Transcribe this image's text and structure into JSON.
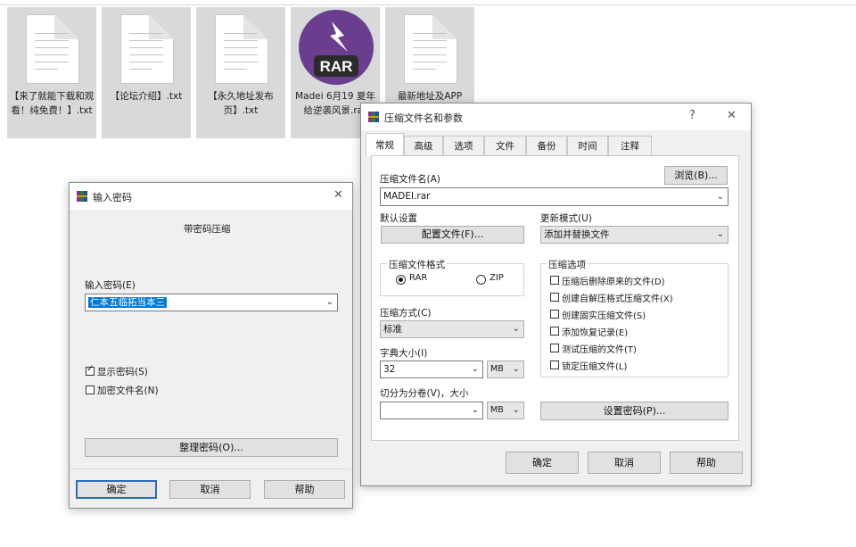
{
  "desktop": {
    "files": [
      {
        "label": "【来了就能下载和观看！纯免费！】.txt"
      },
      {
        "label": "【论坛介绍】.txt"
      },
      {
        "label": "【永久地址发布页】.txt"
      },
      {
        "label": "Madei 6月19 夏年给逆袭风景.rar",
        "badge": "RAR"
      },
      {
        "label": "最新地址及APP"
      }
    ]
  },
  "password_dialog": {
    "title": "输入密码",
    "heading": "带密码压缩",
    "password_label": "输入密码(E)",
    "password_value": "仁本五临拓当本三",
    "show_password_label": "显示密码(S)",
    "show_password_checked": true,
    "encrypt_names_label": "加密文件名(N)",
    "encrypt_names_checked": false,
    "manage_button": "整理密码(O)...",
    "ok_button": "确定",
    "cancel_button": "取消",
    "help_button": "帮助"
  },
  "archive_dialog": {
    "title": "压缩文件名和参数",
    "help_glyph": "?",
    "close_glyph": "✕",
    "tabs": [
      "常规",
      "高级",
      "选项",
      "文件",
      "备份",
      "时间",
      "注释"
    ],
    "active_tab": 0,
    "archive_name_label": "压缩文件名(A)",
    "browse_button": "浏览(B)...",
    "archive_name_value": "MADEI.rar",
    "default_settings_label": "默认设置",
    "profiles_button": "配置文件(F)...",
    "update_mode_label": "更新模式(U)",
    "update_mode_value": "添加并替换文件",
    "format_group_label": "压缩文件格式",
    "format_rar": "RAR",
    "format_zip": "ZIP",
    "format_selected": "RAR",
    "method_label": "压缩方式(C)",
    "method_value": "标准",
    "dict_label": "字典大小(I)",
    "dict_value": "32",
    "dict_unit": "MB",
    "split_label": "切分为分卷(V)，大小",
    "split_value": "",
    "split_unit": "MB",
    "options_group_label": "压缩选项",
    "options": [
      {
        "label": "压缩后删除原来的文件(D)",
        "checked": false
      },
      {
        "label": "创建自解压格式压缩文件(X)",
        "checked": false
      },
      {
        "label": "创建固实压缩文件(S)",
        "checked": false
      },
      {
        "label": "添加恢复记录(E)",
        "checked": false
      },
      {
        "label": "测试压缩的文件(T)",
        "checked": false
      },
      {
        "label": "锁定压缩文件(L)",
        "checked": false
      }
    ],
    "set_password_button": "设置密码(P)...",
    "ok_button": "确定",
    "cancel_button": "取消",
    "help_button": "帮助"
  },
  "colors": {
    "accent": "#2f6bbd",
    "selection": "#0078d7",
    "rar_purple": "#6b3d8f"
  }
}
